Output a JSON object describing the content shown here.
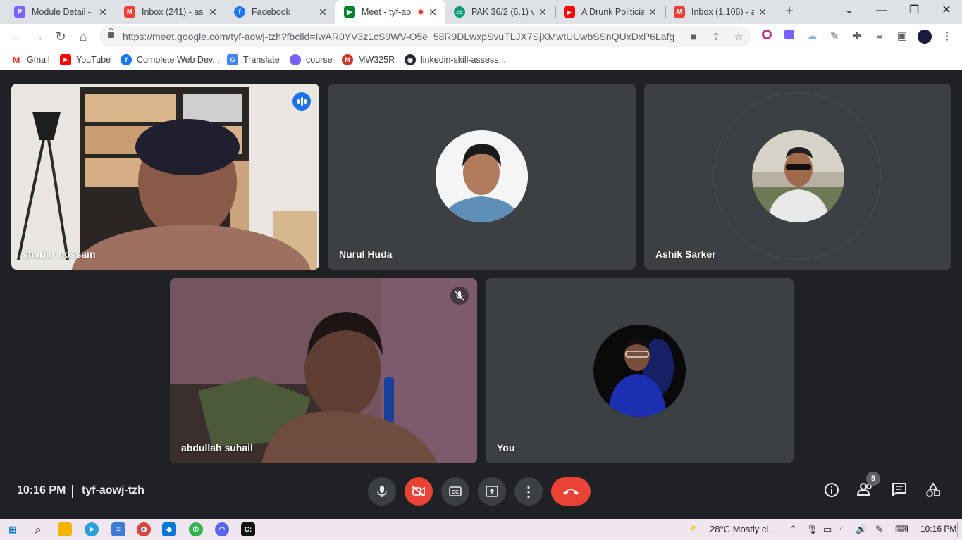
{
  "browser": {
    "tabs": [
      {
        "title": "Module Detail - P",
        "icon": "module-icon",
        "color": "#7b61ff",
        "active": false
      },
      {
        "title": "Inbox (241) - ash",
        "icon": "gmail-icon",
        "color": "#ea4335",
        "active": false
      },
      {
        "title": "Facebook",
        "icon": "facebook-icon",
        "color": "#1877f2",
        "active": false
      },
      {
        "title": "Meet - tyf-ao",
        "icon": "meet-icon",
        "color": "#00832d",
        "active": true
      },
      {
        "title": "PAK 36/2 (6.1) vs",
        "icon": "cricbuzz-icon",
        "color": "#0a9b78",
        "active": false
      },
      {
        "title": "A Drunk Politician",
        "icon": "youtube-icon",
        "color": "#ff0000",
        "active": false
      },
      {
        "title": "Inbox (1,106) - as",
        "icon": "gmail-icon",
        "color": "#ea4335",
        "active": false
      }
    ],
    "url": "https://meet.google.com/tyf-aowj-tzh?fbclid=IwAR0YV3z1cS9WV-O5e_58R9DLwxpSvuTLJX7SjXMwtUUwbSSnQUxDxP6Lafg",
    "bookmarks": [
      {
        "label": "Gmail",
        "icon": "gmail-icon",
        "color": "#ea4335"
      },
      {
        "label": "YouTube",
        "icon": "youtube-icon",
        "color": "#ff0000"
      },
      {
        "label": "Complete Web Dev...",
        "icon": "facebook-icon",
        "color": "#1877f2"
      },
      {
        "label": "Translate",
        "icon": "translate-icon",
        "color": "#4285f4"
      },
      {
        "label": "course",
        "icon": "course-icon",
        "color": "#7b61ff"
      },
      {
        "label": "MW325R",
        "icon": "mercusys-icon",
        "color": "#d93025"
      },
      {
        "label": "linkedin-skill-assess...",
        "icon": "github-icon",
        "color": "#24292f"
      }
    ]
  },
  "meet": {
    "participants": [
      {
        "name": "shariar hossain",
        "type": "video",
        "speaking": true
      },
      {
        "name": "Nurul Huda",
        "type": "avatar"
      },
      {
        "name": "Ashik Sarker",
        "type": "avatar"
      },
      {
        "name": "abdullah suhail",
        "type": "video",
        "muted": true
      },
      {
        "name": "You",
        "type": "avatar"
      }
    ],
    "time": "10:16 PM",
    "meeting_code": "tyf-aowj-tzh",
    "participant_count": "5",
    "accent_red": "#ea4335",
    "speaking_blue": "#1a73e8"
  },
  "taskbar": {
    "weather": "28°C  Mostly cl...",
    "time": "10:16 PM"
  }
}
